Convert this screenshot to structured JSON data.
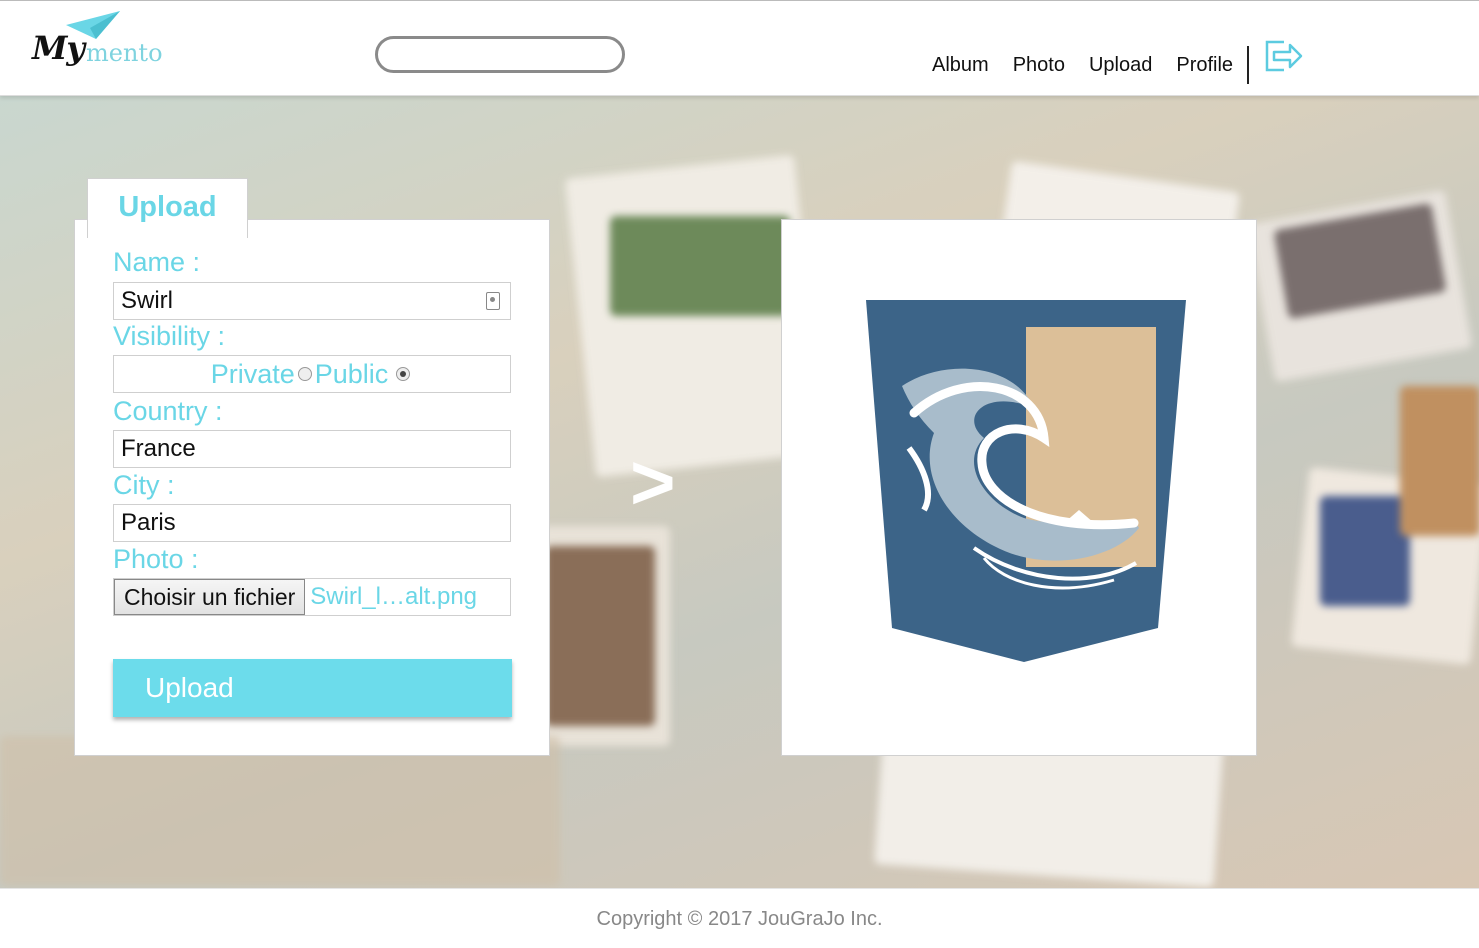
{
  "header": {
    "logo": {
      "my": "My",
      "mento": "mento"
    },
    "search": {
      "placeholder": ""
    },
    "nav": [
      "Album",
      "Photo",
      "Upload",
      "Profile"
    ]
  },
  "upload_form": {
    "tab_label": "Upload",
    "name_label": "Name :",
    "name_value": "Swirl",
    "visibility_label": "Visibility :",
    "visibility_options": [
      "Private",
      "Public"
    ],
    "visibility_selected": "Public",
    "country_label": "Country :",
    "country_value": "France",
    "city_label": "City :",
    "city_value": "Paris",
    "photo_label": "Photo :",
    "file_button": "Choisir un fichier",
    "file_name": "Swirl_l…alt.png",
    "submit": "Upload"
  },
  "arrow": ">",
  "footer": {
    "copyright": "Copyright © 2017 JouGraJo Inc."
  },
  "colors": {
    "accent": "#6ad6e6",
    "button": "#6cdceb",
    "shield": "#3c6488",
    "sand": "#dcbf98"
  }
}
